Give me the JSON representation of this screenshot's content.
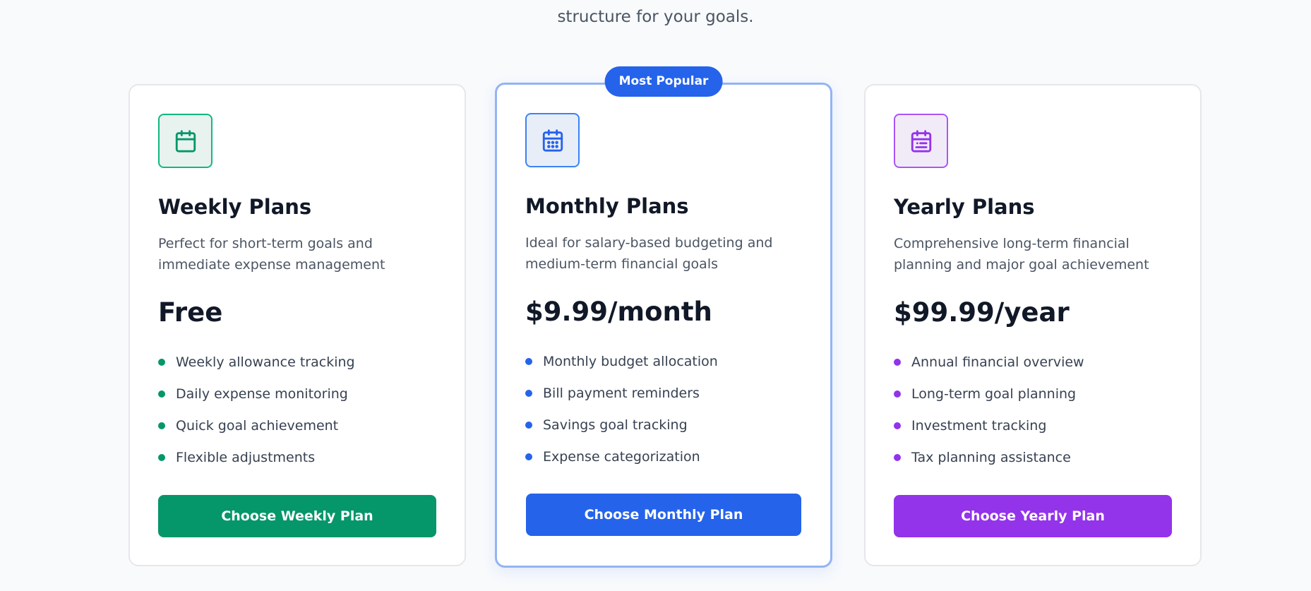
{
  "intro": {
    "line1": "Choose your financial plan structure for your goals.",
    "line2": "structure for your goals."
  },
  "plans": [
    {
      "id": "weekly",
      "icon": "calendar-icon",
      "accent": "#059669",
      "title": "Weekly Plans",
      "description": "Perfect for short-term goals and immediate expense management",
      "price": "Free",
      "features": [
        "Weekly allowance tracking",
        "Daily expense monitoring",
        "Quick goal achievement",
        "Flexible adjustments"
      ],
      "cta": "Choose Weekly Plan"
    },
    {
      "id": "monthly",
      "icon": "calendar-days-icon",
      "accent": "#2563eb",
      "badge": "Most Popular",
      "title": "Monthly Plans",
      "description": "Ideal for salary-based budgeting and medium-term financial goals",
      "price": "$9.99/month",
      "features": [
        "Monthly budget allocation",
        "Bill payment reminders",
        "Savings goal tracking",
        "Expense categorization"
      ],
      "cta": "Choose Monthly Plan"
    },
    {
      "id": "yearly",
      "icon": "calendar-range-icon",
      "accent": "#9333ea",
      "title": "Yearly Plans",
      "description": "Comprehensive long-term financial planning and major goal achievement",
      "price": "$99.99/year",
      "features": [
        "Annual financial overview",
        "Long-term goal planning",
        "Investment tracking",
        "Tax planning assistance"
      ],
      "cta": "Choose Yearly Plan"
    }
  ]
}
